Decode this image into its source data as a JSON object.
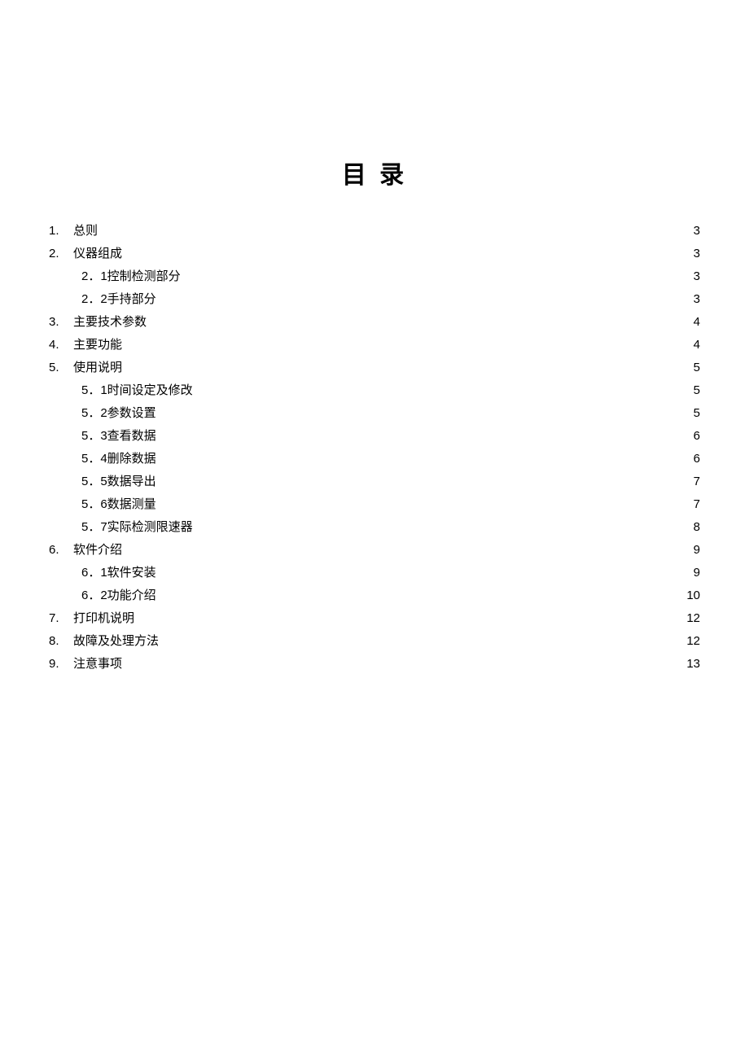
{
  "title": "目 录",
  "toc": [
    {
      "level": 1,
      "num": "1.",
      "label": "总则",
      "page": "3"
    },
    {
      "level": 1,
      "num": "2.",
      "label": "仪器组成",
      "page": "3"
    },
    {
      "level": 2,
      "num": "",
      "label": "2．1控制检测部分",
      "page": "3"
    },
    {
      "level": 2,
      "num": "",
      "label": "2．2手持部分",
      "page": "3"
    },
    {
      "level": 1,
      "num": "3.",
      "label": "主要技术参数",
      "page": "4"
    },
    {
      "level": 1,
      "num": "4.",
      "label": "主要功能",
      "page": "4"
    },
    {
      "level": 1,
      "num": "5.",
      "label": "使用说明",
      "page": "5"
    },
    {
      "level": 2,
      "num": "",
      "label": "5．1时间设定及修改",
      "page": "5"
    },
    {
      "level": 2,
      "num": "",
      "label": "5．2参数设置",
      "page": "5"
    },
    {
      "level": 2,
      "num": "",
      "label": "5．3查看数据",
      "page": "6"
    },
    {
      "level": 2,
      "num": "",
      "label": "5．4删除数据",
      "page": "6"
    },
    {
      "level": 2,
      "num": "",
      "label": "5．5数据导出",
      "page": "7"
    },
    {
      "level": 2,
      "num": "",
      "label": "5．6数据测量",
      "page": "7"
    },
    {
      "level": 2,
      "num": "",
      "label": "5．7实际检测限速器",
      "page": "8"
    },
    {
      "level": 1,
      "num": "6.",
      "label": "软件介绍",
      "page": "9"
    },
    {
      "level": 2,
      "num": "",
      "label": "6．1软件安装",
      "page": "9"
    },
    {
      "level": 2,
      "num": "",
      "label": "6．2功能介绍",
      "page": "10"
    },
    {
      "level": 1,
      "num": "7.",
      "label": "打印机说明",
      "page": "12"
    },
    {
      "level": 1,
      "num": "8.",
      "label": "故障及处理方法",
      "page": "12"
    },
    {
      "level": 1,
      "num": "9.",
      "label": "注意事项",
      "page": "13"
    }
  ]
}
